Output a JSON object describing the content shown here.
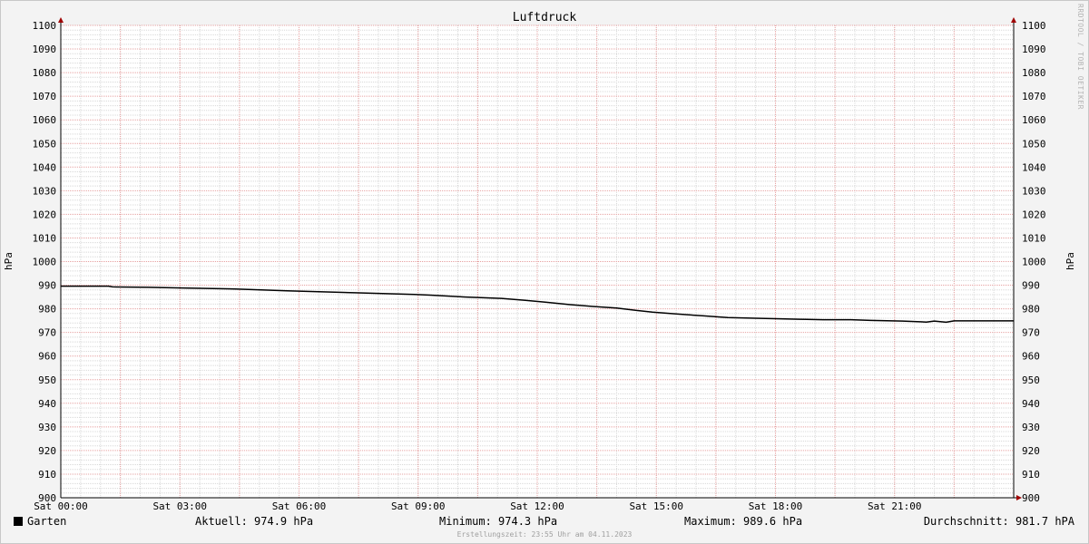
{
  "chart_data": {
    "type": "line",
    "title": "Luftdruck",
    "ylabel": "hPa",
    "ylabel_right": "hPa",
    "ylim": [
      900,
      1100
    ],
    "y_ticks": [
      900,
      910,
      920,
      930,
      940,
      950,
      960,
      970,
      980,
      990,
      1000,
      1010,
      1020,
      1030,
      1040,
      1050,
      1060,
      1070,
      1080,
      1090,
      1100
    ],
    "xlim": [
      0,
      24
    ],
    "x_ticks": [
      {
        "x": 0,
        "label": "Sat 00:00"
      },
      {
        "x": 3,
        "label": "Sat 03:00"
      },
      {
        "x": 6,
        "label": "Sat 06:00"
      },
      {
        "x": 9,
        "label": "Sat 09:00"
      },
      {
        "x": 12,
        "label": "Sat 12:00"
      },
      {
        "x": 15,
        "label": "Sat 15:00"
      },
      {
        "x": 18,
        "label": "Sat 18:00"
      },
      {
        "x": 21,
        "label": "Sat 21:00"
      }
    ],
    "grid": true,
    "series": [
      {
        "name": "Garten",
        "color": "#000000",
        "x": [
          0,
          1.2,
          1.3,
          2.2,
          3.2,
          4.4,
          5.7,
          7.4,
          8.9,
          9.3,
          10.2,
          11.1,
          11.7,
          12.2,
          12.8,
          13.4,
          14.0,
          14.5,
          14.9,
          15.5,
          16.2,
          16.8,
          17.5,
          18.0,
          18.6,
          19.2,
          19.9,
          20.4,
          21.2,
          21.8,
          22.0,
          22.3,
          22.5,
          23.0,
          24.0
        ],
        "y": [
          989.6,
          989.6,
          989.3,
          989.1,
          988.8,
          988.4,
          987.6,
          986.8,
          986.1,
          985.8,
          985.0,
          984.4,
          983.6,
          982.8,
          981.8,
          981.0,
          980.3,
          979.3,
          978.6,
          977.8,
          977.0,
          976.3,
          976.0,
          975.8,
          975.6,
          975.4,
          975.4,
          975.1,
          974.8,
          974.4,
          974.8,
          974.3,
          974.9,
          974.9,
          974.9
        ]
      }
    ]
  },
  "legend": {
    "series_label": "Garten",
    "current": "Aktuell: 974.9 hPa",
    "minimum": "Minimum: 974.3 hPa",
    "maximum": "Maximum: 989.6 hPa",
    "average": "Durchschnitt: 981.7 hPA"
  },
  "footer": "Erstellungszeit: 23:55 Uhr am 04.11.2023",
  "watermark": "RRDTOOL / TOBI OETIKER"
}
